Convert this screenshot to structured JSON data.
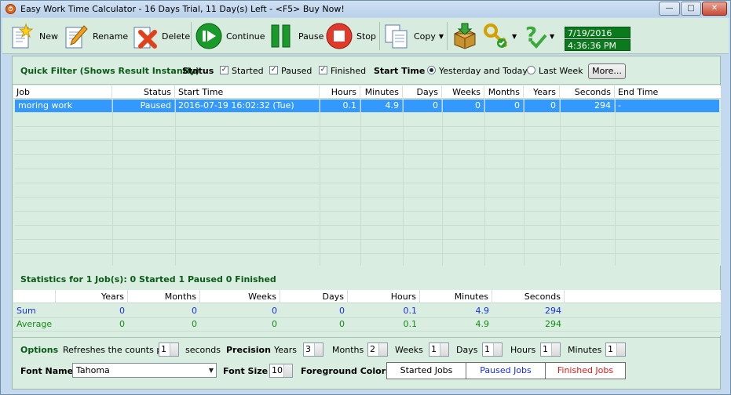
{
  "title": "Easy Work Time Calculator - 16 Days Trial, 11 Day(s) Left  - <F5> Buy Now!",
  "window_buttons": {
    "minimize": "—",
    "maximize": "□",
    "close": "✕"
  },
  "toolbar": {
    "new": "New",
    "rename": "Rename",
    "delete": "Delete",
    "continue": "Continue",
    "pause": "Pause",
    "stop": "Stop",
    "copy": "Copy",
    "date": "7/19/2016",
    "time": "4:36:36 PM"
  },
  "filter": {
    "title": "Quick Filter (Shows Result Instantly)",
    "status_label": "Status",
    "started": "Started",
    "paused": "Paused",
    "finished": "Finished",
    "start_time_label": "Start Time",
    "yesterday_today": "Yesterday and Today",
    "last_week": "Last Week",
    "more": "More..."
  },
  "grid": {
    "columns": [
      "Job",
      "Status",
      "Start Time",
      "Hours",
      "Minutes",
      "Days",
      "Weeks",
      "Months",
      "Years",
      "Seconds",
      "End Time"
    ],
    "rows": [
      [
        "moring work",
        "Paused",
        "2016-07-19 16:02:32 (Tue)",
        "0.1",
        "4.9",
        "0",
        "0",
        "0",
        "0",
        "294",
        "-"
      ]
    ]
  },
  "stats": {
    "title": "Statistics for 1 Job(s): 0 Started 1 Paused 0 Finished",
    "columns": [
      "",
      "Years",
      "Months",
      "Weeks",
      "Days",
      "Hours",
      "Minutes",
      "Seconds"
    ],
    "sum": [
      "Sum",
      "0",
      "0",
      "0",
      "0",
      "0.1",
      "4.9",
      "294"
    ],
    "average": [
      "Average",
      "0",
      "0",
      "0",
      "0",
      "0.1",
      "4.9",
      "294"
    ]
  },
  "options": {
    "options_label": "Options",
    "refresh_label": "Refreshes the counts per",
    "refresh_value": "1",
    "seconds": "seconds",
    "precision_label": "Precision",
    "years": "Years",
    "years_value": "3",
    "months": "Months",
    "months_value": "2",
    "weeks": "Weeks",
    "weeks_value": "1",
    "days": "Days",
    "days_value": "1",
    "hours": "Hours",
    "hours_value": "1",
    "minutes": "Minutes",
    "minutes_value": "1",
    "font_name_label": "Font Name",
    "font_name_value": "Tahoma",
    "font_size_label": "Font Size",
    "font_size_value": "10",
    "fg_colors_label": "Foreground Colors",
    "started_jobs": "Started Jobs",
    "paused_jobs": "Paused Jobs",
    "finished_jobs": "Finished Jobs"
  },
  "colors": {
    "selection": "#3399ff",
    "sum": "#1a2ee0",
    "average": "#138c13",
    "paused": "#1a2ee0",
    "finished": "#e01a1a"
  }
}
